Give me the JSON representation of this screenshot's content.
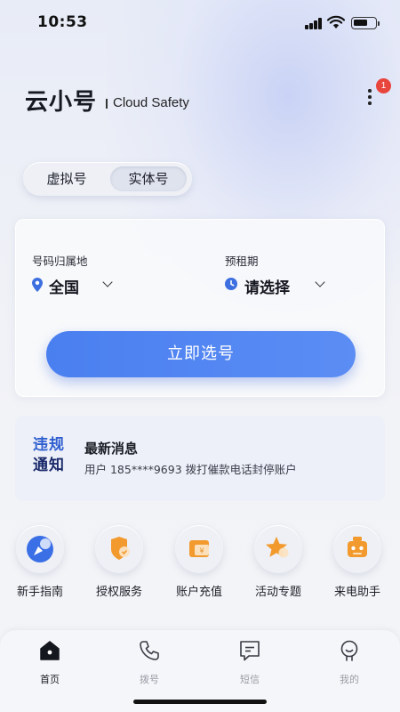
{
  "status_bar": {
    "time": "10:53"
  },
  "header": {
    "title": "云小号",
    "subtitle": "Cloud Safety",
    "notification_count": "1"
  },
  "tabs": [
    {
      "label": "虚拟号",
      "selected": false
    },
    {
      "label": "实体号",
      "selected": true
    }
  ],
  "selector": {
    "location_label": "号码归属地",
    "location_value": "全国",
    "period_label": "预租期",
    "period_value": "请选择",
    "action_label": "立即选号"
  },
  "notice": {
    "logo_line1": "违规",
    "logo_line2": "通知",
    "title": "最新消息",
    "text": "用户 185****9693 拨打催款电话封停账户"
  },
  "features": [
    {
      "label": "新手指南",
      "icon": "compass-icon"
    },
    {
      "label": "授权服务",
      "icon": "shield-icon"
    },
    {
      "label": "账户充值",
      "icon": "wallet-icon"
    },
    {
      "label": "活动专题",
      "icon": "star-icon"
    },
    {
      "label": "来电助手",
      "icon": "robot-icon"
    }
  ],
  "bottom_nav": [
    {
      "label": "首页",
      "icon": "home-icon",
      "active": true
    },
    {
      "label": "拨号",
      "icon": "phone-icon",
      "active": false
    },
    {
      "label": "短信",
      "icon": "message-icon",
      "active": false
    },
    {
      "label": "我的",
      "icon": "profile-icon",
      "active": false
    }
  ],
  "colors": {
    "primary": "#4a7ff0",
    "badge": "#e8453c",
    "accent_orange": "#f29a2e",
    "navy": "#1a2a6b"
  }
}
